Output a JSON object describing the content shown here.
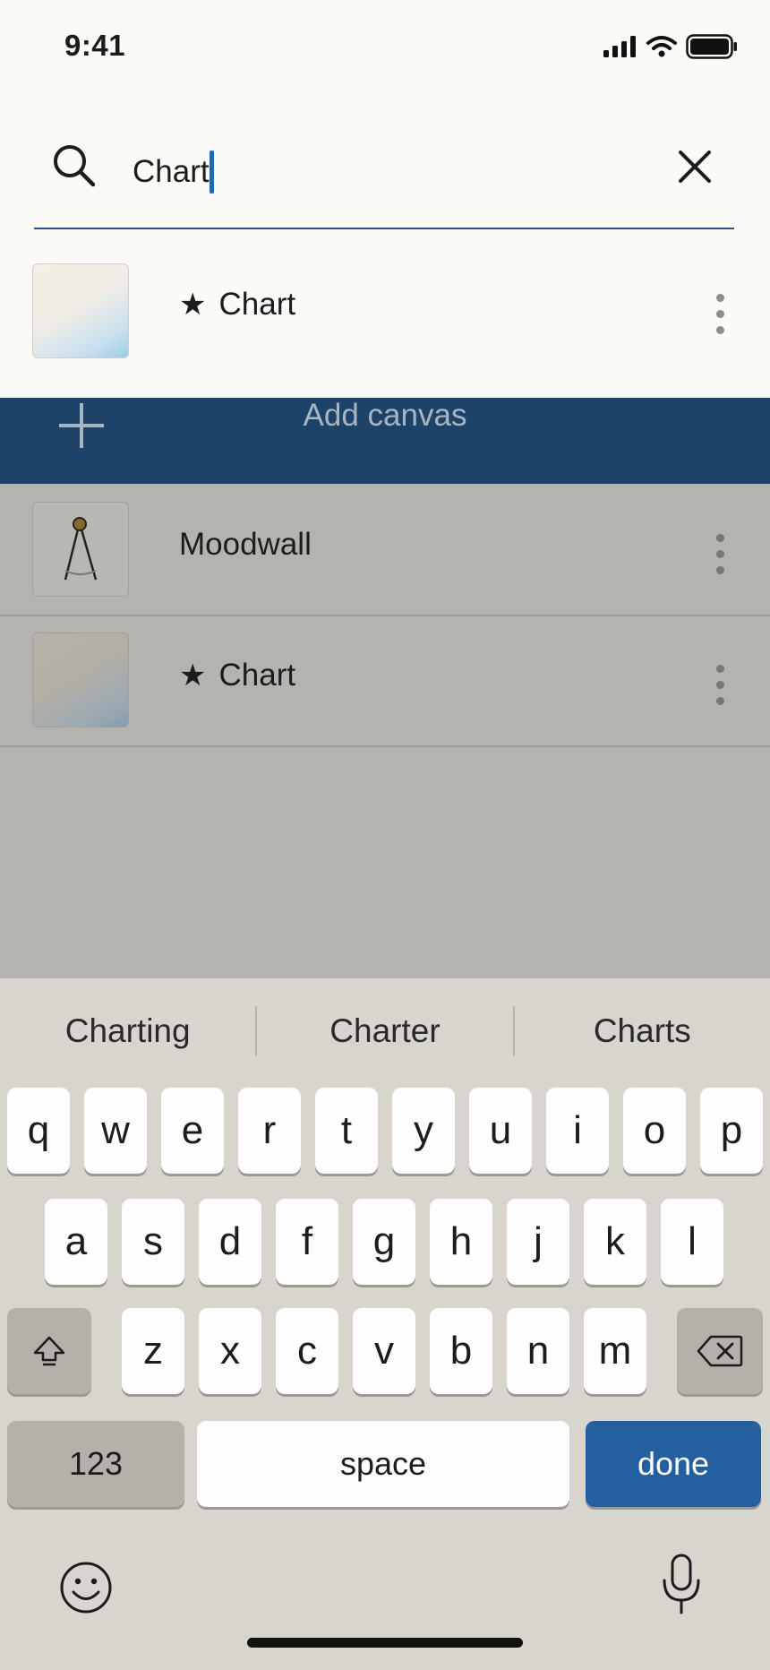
{
  "status": {
    "time": "9:41"
  },
  "search": {
    "query": "Chart"
  },
  "result": {
    "title": "Chart",
    "starred": true
  },
  "add_canvas": {
    "label": "Add canvas"
  },
  "canvases": [
    {
      "title": "Moodwall",
      "starred": false
    },
    {
      "title": "Chart",
      "starred": true
    }
  ],
  "keyboard": {
    "suggestions": [
      "Charting",
      "Charter",
      "Charts"
    ],
    "row1": [
      "q",
      "w",
      "e",
      "r",
      "t",
      "y",
      "u",
      "i",
      "o",
      "p"
    ],
    "row2": [
      "a",
      "s",
      "d",
      "f",
      "g",
      "h",
      "j",
      "k",
      "l"
    ],
    "row3": [
      "z",
      "x",
      "c",
      "v",
      "b",
      "n",
      "m"
    ],
    "numbers_label": "123",
    "space_label": "space",
    "done_label": "done"
  },
  "colors": {
    "accent": "#2460a0",
    "add_bar": "#1d4368",
    "dim": "#b5b3af",
    "keyboard_bg": "#d8d5cf"
  }
}
